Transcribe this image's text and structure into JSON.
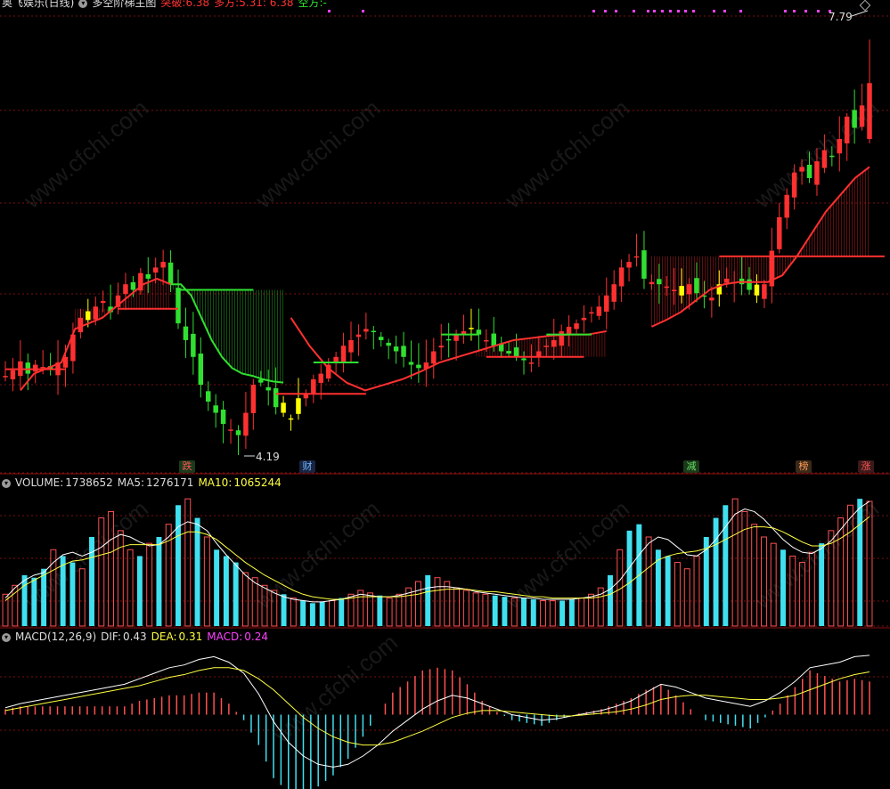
{
  "main_header": {
    "title": "奥飞娱乐(日线)",
    "indicator": "多空阶梯主图",
    "breakout_label": "突破:",
    "breakout_value": "6.38",
    "long_label": "多方:",
    "long_value": "5.31",
    "long_value2": ": 6.38",
    "empty_label": "空方:",
    "empty_value": "-"
  },
  "volume_header": {
    "name": "VOLUME:",
    "value": "1738652",
    "ma5_label": "MA5:",
    "ma5_value": "1276171",
    "ma10_label": "MA10:",
    "ma10_value": "1065244"
  },
  "macd_header": {
    "name": "MACD(12,26,9)",
    "dif_label": "DIF:",
    "dif_value": "0.43",
    "dea_label": "DEA:",
    "dea_value": "0.31",
    "macd_label": "MACD:",
    "macd_value": "0.24"
  },
  "annotations": {
    "high_price": "7.79",
    "low_price": "4.19"
  },
  "markers": [
    {
      "text": "跌",
      "bg": "#1a3a1a",
      "fg": "#ff5555"
    },
    {
      "text": "财",
      "bg": "#1a2440",
      "fg": "#6ab4ff"
    },
    {
      "text": "减",
      "bg": "#1a3a1a",
      "fg": "#66dd66"
    },
    {
      "text": "榜",
      "bg": "#3a2a1a",
      "fg": "#ff9955"
    },
    {
      "text": "涨",
      "bg": "#3a1a1a",
      "fg": "#ff5555"
    }
  ],
  "watermark": "www.cfchi.com",
  "colors": {
    "up": "#ff3030",
    "down": "#30e030",
    "neutral": "#ffff00",
    "grid": "#7a1010",
    "vol_up": "#ff5050",
    "vol_down": "#40e0f0",
    "ma_white": "#ffffff",
    "ma_yellow": "#ffff40",
    "macd_magenta": "#ff40ff"
  },
  "chart_data": [
    {
      "type": "candlestick",
      "title": "奥飞娱乐(日线)",
      "ylim": [
        4.0,
        8.0
      ],
      "series": [
        {
          "name": "K",
          "values": [
            4.78,
            4.83,
            4.91,
            4.8,
            4.88,
            4.86,
            4.84,
            4.9,
            4.95,
            5.15,
            5.3,
            5.28,
            5.4,
            5.45,
            5.35,
            5.5,
            5.6,
            5.55,
            5.7,
            5.65,
            5.75,
            5.8,
            5.6,
            5.25,
            5.1,
            4.95,
            4.7,
            4.55,
            4.45,
            4.35,
            4.3,
            4.25,
            4.45,
            4.7,
            4.72,
            4.65,
            4.5,
            4.45,
            4.4,
            4.58,
            4.62,
            4.75,
            4.8,
            4.88,
            4.95,
            5.05,
            5.1,
            5.15,
            5.2,
            5.18,
            5.1,
            5.05,
            5.0,
            4.95,
            4.88,
            4.85,
            4.9,
            5.0,
            5.05,
            5.1,
            5.15,
            5.18,
            5.2,
            5.15,
            5.1,
            5.05,
            5.0,
            4.98,
            4.95,
            4.92,
            4.9,
            5.0,
            5.05,
            5.1,
            5.18,
            5.22,
            5.25,
            5.3,
            5.35,
            5.4,
            5.5,
            5.6,
            5.75,
            5.8,
            5.85,
            5.65,
            5.62,
            5.6,
            5.58,
            5.55,
            5.5,
            5.6,
            5.52,
            5.5,
            5.48,
            5.6,
            5.65,
            5.62,
            5.6,
            5.55,
            5.5,
            5.6,
            5.9,
            6.2,
            6.4,
            6.6,
            6.65,
            6.55,
            6.7,
            6.8,
            6.75,
            6.9,
            7.1,
            7.0,
            7.2,
            7.4
          ]
        },
        {
          "name": "多方",
          "values": [
            4.65,
            4.8,
            4.85,
            4.9,
            5.2,
            5.25,
            5.3,
            5.4,
            5.5,
            5.6,
            5.65,
            5.6,
            5.3,
            5.05,
            4.85,
            4.72,
            4.65,
            4.7,
            4.75,
            4.82,
            4.9,
            4.95,
            5.0,
            5.05,
            5.1,
            5.12,
            5.14,
            5.15,
            5.15,
            5.18,
            5.22,
            5.28,
            5.35,
            5.45,
            5.55,
            5.6,
            5.62,
            5.62,
            5.62,
            5.68,
            5.85,
            6.05,
            6.25,
            6.4,
            6.55,
            6.65
          ]
        },
        {
          "name": "空方",
          "values": [
            5.6,
            5.6,
            5.5,
            5.3,
            5.1,
            4.95,
            4.85,
            4.8,
            4.78,
            4.75,
            4.73,
            4.72
          ]
        }
      ],
      "annotations": [
        {
          "label": "7.79",
          "type": "high"
        },
        {
          "label": "4.19",
          "type": "low"
        }
      ]
    },
    {
      "type": "bar",
      "title": "VOLUME",
      "series": [
        {
          "name": "VOLUME",
          "values": [
            25,
            32,
            40,
            38,
            45,
            60,
            55,
            50,
            45,
            70,
            85,
            90,
            75,
            60,
            55,
            65,
            70,
            80,
            95,
            100,
            85,
            70,
            60,
            55,
            50,
            42,
            38,
            32,
            28,
            25,
            22,
            20,
            18,
            19,
            20,
            22,
            25,
            28,
            26,
            24,
            22,
            25,
            30,
            35,
            40,
            38,
            35,
            30,
            28,
            26,
            25,
            24,
            23,
            22,
            22,
            21,
            20,
            20,
            20,
            21,
            22,
            25,
            30,
            40,
            60,
            75,
            80,
            70,
            60,
            55,
            50,
            45,
            55,
            70,
            85,
            95,
            100,
            90,
            80,
            70,
            65,
            60,
            55,
            50,
            58,
            65,
            75,
            85,
            95,
            100,
            98
          ]
        },
        {
          "name": "MA5",
          "values": [
            22,
            30,
            36,
            40,
            42,
            50,
            56,
            58,
            55,
            58,
            62,
            68,
            72,
            70,
            66,
            63,
            64,
            70,
            78,
            82,
            80,
            75,
            65,
            56,
            48,
            40,
            34,
            30,
            26,
            23,
            21,
            20,
            19,
            19,
            20,
            21,
            23,
            25,
            24,
            23,
            23,
            24,
            26,
            28,
            30,
            31,
            31,
            30,
            29,
            27,
            26,
            25,
            24,
            23,
            22,
            22,
            21,
            21,
            21,
            21,
            22,
            23,
            25,
            29,
            36,
            46,
            56,
            65,
            70,
            68,
            62,
            56,
            55,
            60,
            68,
            78,
            88,
            92,
            90,
            84,
            76,
            68,
            62,
            58,
            57,
            61,
            67,
            76,
            85,
            93,
            98
          ]
        },
        {
          "name": "MA10",
          "values": [
            20,
            26,
            32,
            36,
            40,
            44,
            48,
            51,
            52,
            54,
            56,
            58,
            62,
            64,
            64,
            64,
            64,
            67,
            71,
            74,
            74,
            72,
            68,
            62,
            56,
            50,
            45,
            40,
            36,
            32,
            28,
            25,
            23,
            22,
            21,
            21,
            22,
            23,
            23,
            23,
            23,
            23,
            24,
            25,
            27,
            28,
            29,
            29,
            29,
            28,
            27,
            27,
            26,
            25,
            24,
            23,
            23,
            22,
            22,
            22,
            22,
            22,
            23,
            25,
            29,
            34,
            40,
            46,
            52,
            55,
            57,
            58,
            59,
            61,
            64,
            68,
            72,
            76,
            78,
            78,
            77,
            74,
            70,
            66,
            63,
            63,
            65,
            69,
            74,
            80,
            86
          ]
        }
      ]
    },
    {
      "type": "line",
      "title": "MACD(12,26,9)",
      "series": [
        {
          "name": "DIF",
          "values": [
            0.05,
            0.08,
            0.1,
            0.12,
            0.14,
            0.16,
            0.18,
            0.2,
            0.22,
            0.26,
            0.3,
            0.34,
            0.36,
            0.4,
            0.42,
            0.38,
            0.3,
            0.15,
            -0.05,
            -0.2,
            -0.3,
            -0.36,
            -0.38,
            -0.36,
            -0.3,
            -0.22,
            -0.12,
            -0.04,
            0.04,
            0.1,
            0.14,
            0.12,
            0.08,
            0.04,
            0.0,
            -0.02,
            -0.04,
            -0.03,
            -0.01,
            0.01,
            0.03,
            0.06,
            0.1,
            0.16,
            0.22,
            0.2,
            0.16,
            0.12,
            0.1,
            0.08,
            0.06,
            0.1,
            0.16,
            0.24,
            0.34,
            0.36,
            0.38,
            0.42,
            0.43
          ]
        },
        {
          "name": "DEA",
          "values": [
            0.03,
            0.05,
            0.07,
            0.09,
            0.11,
            0.13,
            0.15,
            0.17,
            0.19,
            0.21,
            0.24,
            0.27,
            0.29,
            0.32,
            0.34,
            0.34,
            0.32,
            0.26,
            0.18,
            0.08,
            -0.02,
            -0.1,
            -0.16,
            -0.2,
            -0.22,
            -0.22,
            -0.2,
            -0.16,
            -0.12,
            -0.07,
            -0.02,
            0.01,
            0.03,
            0.03,
            0.02,
            0.01,
            0.0,
            -0.01,
            -0.01,
            0.0,
            0.01,
            0.02,
            0.04,
            0.07,
            0.11,
            0.13,
            0.14,
            0.14,
            0.13,
            0.12,
            0.11,
            0.11,
            0.12,
            0.14,
            0.18,
            0.22,
            0.26,
            0.29,
            0.31
          ]
        }
      ]
    }
  ]
}
